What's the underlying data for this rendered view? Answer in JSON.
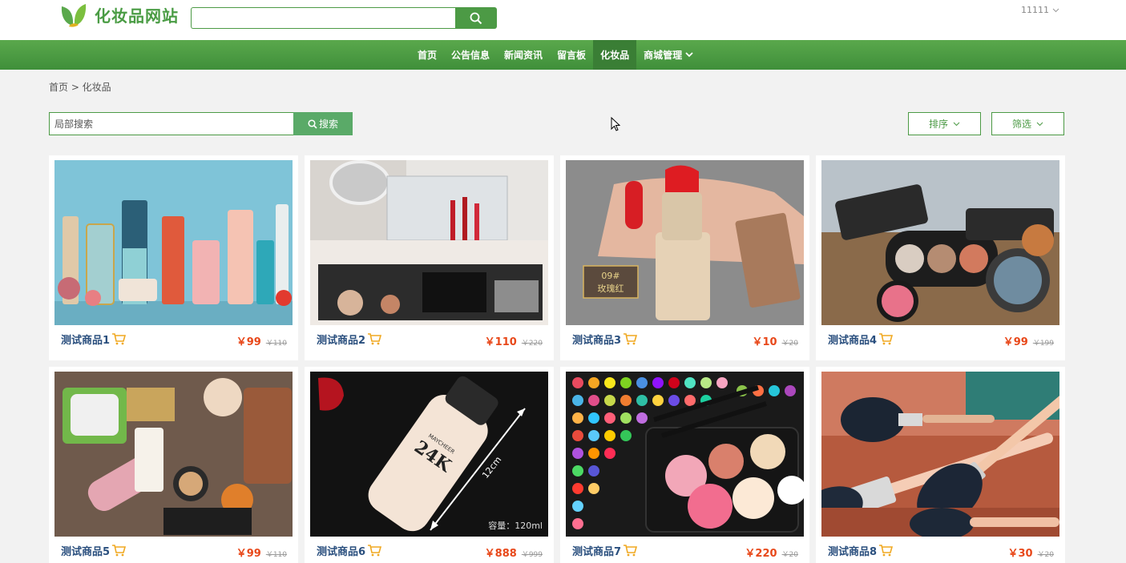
{
  "header": {
    "site_name": "化妆品网站",
    "search_value": "",
    "user_name": "11111"
  },
  "nav": {
    "items": [
      {
        "label": "首页"
      },
      {
        "label": "公告信息"
      },
      {
        "label": "新闻资讯"
      },
      {
        "label": "留言板"
      },
      {
        "label": "化妆品",
        "active": true
      },
      {
        "label": "商城管理",
        "dropdown": true
      }
    ]
  },
  "breadcrumb": "首页 > 化妆品",
  "local_search": {
    "placeholder": "局部搜索",
    "button_label": "搜索"
  },
  "sort_label": "排序",
  "filter_label": "筛选",
  "products": [
    {
      "name": "测试商品1",
      "price": "￥99",
      "original_price": "￥110"
    },
    {
      "name": "测试商品2",
      "price": "￥110",
      "original_price": "￥220"
    },
    {
      "name": "测试商品3",
      "price": "￥10",
      "original_price": "￥20"
    },
    {
      "name": "测试商品4",
      "price": "￥99",
      "original_price": "￥199"
    },
    {
      "name": "测试商品5",
      "price": "￥99",
      "original_price": "￥110"
    },
    {
      "name": "测试商品6",
      "price": "￥888",
      "original_price": "￥999"
    },
    {
      "name": "测试商品7",
      "price": "￥220",
      "original_price": "￥20"
    },
    {
      "name": "测试商品8",
      "price": "￥30",
      "original_price": "￥20"
    }
  ],
  "image_text": {
    "p3_shade": "09#",
    "p3_shade_name": "玫瑰红",
    "p6_label": "24K",
    "p6_brand": "MAYCHEER",
    "p6_size": "12cm",
    "p6_volume": "容量：120ml"
  },
  "colors": {
    "brand_green": "#4c9a45",
    "price_red": "#e8481a",
    "name_blue": "#2a4f7e"
  }
}
